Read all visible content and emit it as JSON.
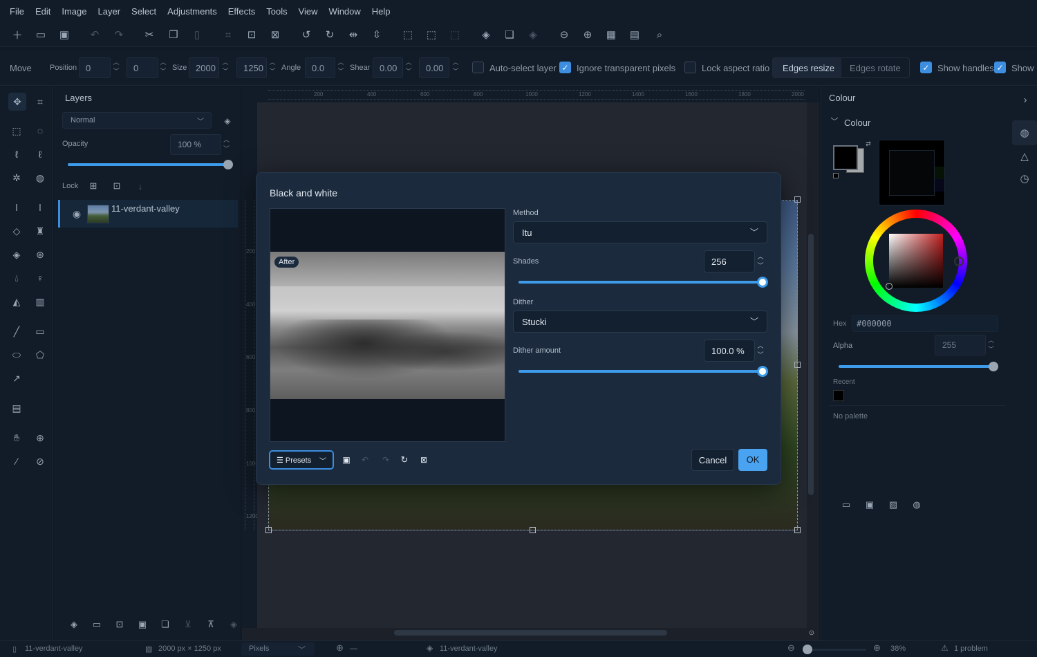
{
  "menu": [
    "File",
    "Edit",
    "Image",
    "Layer",
    "Select",
    "Adjustments",
    "Effects",
    "Tools",
    "View",
    "Window",
    "Help"
  ],
  "options": {
    "tool_name": "Move",
    "position_label": "Position",
    "position_x": "0",
    "position_y": "0",
    "size_label": "Size",
    "size_w": "2000",
    "size_h": "1250",
    "angle_label": "Angle",
    "angle": "0.0",
    "shear_label": "Shear",
    "shear_x": "0.00",
    "shear_y": "0.00",
    "auto_select": "Auto-select layer",
    "ignore_transparent": "Ignore transparent pixels",
    "lock_aspect": "Lock aspect ratio",
    "edges_resize": "Edges resize",
    "edges_rotate": "Edges rotate",
    "show_handles": "Show handles",
    "show_more": "Show"
  },
  "layers": {
    "title": "Layers",
    "blend_mode": "Normal",
    "opacity_label": "Opacity",
    "opacity_value": "100 %",
    "opacity": 1.0,
    "lock_label": "Lock",
    "items": [
      {
        "name": "11-verdant-valley"
      }
    ]
  },
  "ruler": {
    "top": [
      "200",
      "400",
      "600",
      "800",
      "1000",
      "1200",
      "1400",
      "1600",
      "1800",
      "2000"
    ],
    "left": [
      "200",
      "400",
      "600",
      "800",
      "1000",
      "1200"
    ]
  },
  "dialog": {
    "title": "Black and white",
    "preview_badge": "After",
    "method_label": "Method",
    "method_value": "Itu",
    "shades_label": "Shades",
    "shades_value": "256",
    "shades_level": 1.0,
    "dither_label": "Dither",
    "dither_value": "Stucki",
    "dither_amount_label": "Dither amount",
    "dither_amount_value": "100.0 %",
    "dither_amount_level": 1.0,
    "presets_label": "Presets",
    "cancel_label": "Cancel",
    "ok_label": "OK"
  },
  "colour": {
    "panel_title": "Colour",
    "section_title": "Colour",
    "hex_label": "Hex",
    "hex_value": "#000000",
    "alpha_label": "Alpha",
    "alpha_value": "255",
    "alpha_level": 1.0,
    "recent_label": "Recent",
    "palette_text": "No palette",
    "primary_color": "#000000",
    "secondary_color": "#a5a8ab"
  },
  "status": {
    "file": "11-verdant-valley",
    "dimensions": "2000 px × 1250 px",
    "unit": "Pixels",
    "cursor": "—",
    "layer": "11-verdant-valley",
    "zoom": "38%",
    "problems": "1 problem"
  },
  "colors": {
    "accent": "#3d9be9",
    "ok_button": "#4aa3f0"
  }
}
